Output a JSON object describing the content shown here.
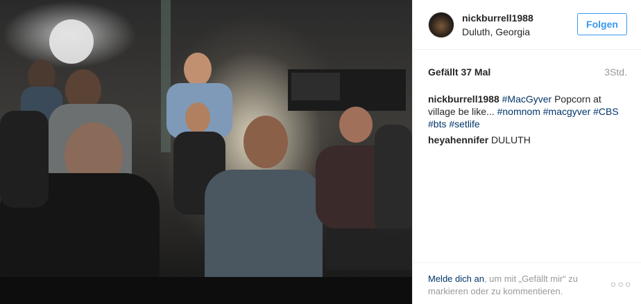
{
  "post": {
    "username": "nickburrell1988",
    "location": "Duluth, Georgia",
    "follow_label": "Folgen",
    "likes": "Gefällt 37 Mal",
    "time": "3Std.",
    "caption_user": "nickburrell1988",
    "caption_parts": {
      "tag1": "#MacGyver",
      "text1": " Popcorn at village be like... ",
      "tag2": "#nomnom",
      "tag3": "#macgyver",
      "tag4": "#CBS",
      "tag5": "#bts",
      "tag6": "#setlife"
    },
    "comment_user": "heyahennifer",
    "comment_text": "DULUTH"
  },
  "footer": {
    "login_link": "Melde dich an",
    "login_text": ", um mit „Gefällt mir“ zu markieren oder zu kommentieren.",
    "more_icon": "more-horizontal-icon"
  },
  "image": {
    "description_icon": "photo"
  }
}
